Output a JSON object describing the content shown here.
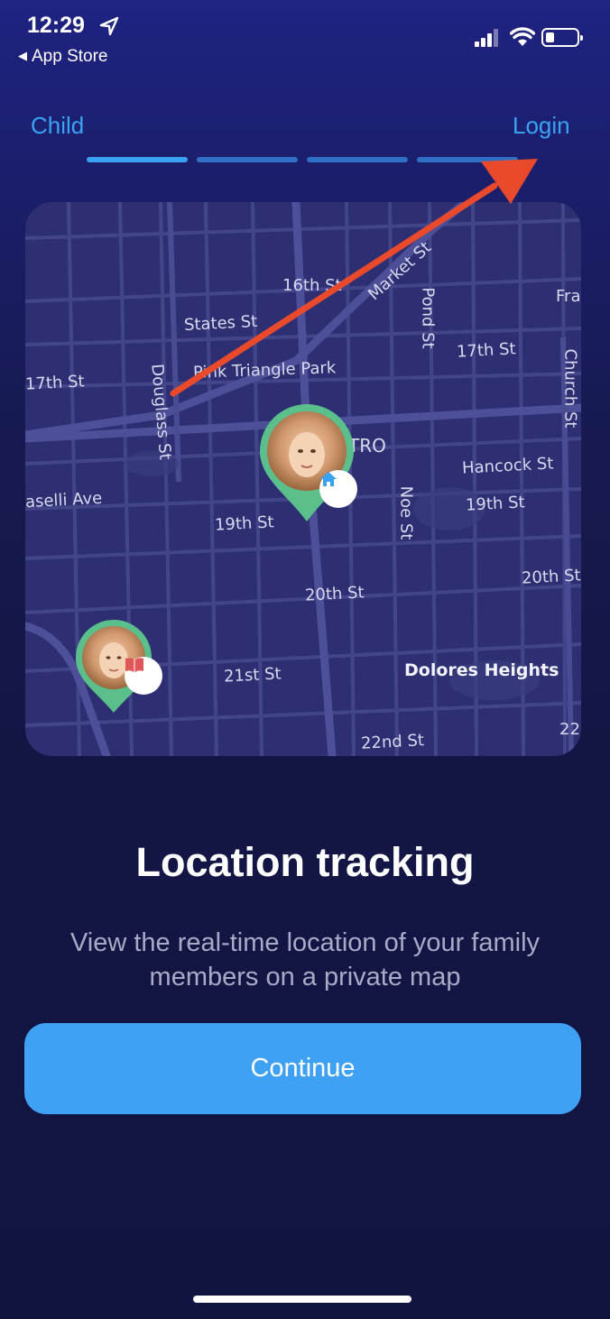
{
  "status_bar": {
    "time": "12:29",
    "back_app": "App Store",
    "icons": [
      "location-arrow-icon",
      "cellular-signal-icon",
      "wifi-icon",
      "battery-icon"
    ]
  },
  "header": {
    "left_label": "Child",
    "right_label": "Login",
    "progress": {
      "total_steps": 4,
      "current_step": 1
    }
  },
  "map": {
    "labels": [
      "16th St",
      "States St",
      "Market St",
      "Pond St",
      "Fra",
      "17th St",
      "17th St",
      "Church St",
      "Pink Triangle Park",
      "Douglass St",
      "TRO",
      "Hancock St",
      "aselli Ave",
      "Noe St",
      "19th St",
      "19th St",
      "20th St",
      "20th St",
      "21st St",
      "Dolores Heights",
      "22nd St",
      "22"
    ],
    "pins": [
      {
        "name": "child-pin-home",
        "badge_icon": "home-icon"
      },
      {
        "name": "child-pin-school",
        "badge_icon": "book-icon"
      }
    ]
  },
  "content": {
    "title": "Location tracking",
    "description": "View the real-time location of your family members on a private map",
    "continue_label": "Continue"
  },
  "colors": {
    "accent": "#3aa2f2",
    "button": "#3ea1f3",
    "progress_active": "#3aa2f2",
    "progress_inactive": "#2f6fc6",
    "pin_green": "#5bbf8c",
    "annotation_arrow": "#e84a2b",
    "badge_school": "#e0575a",
    "badge_home": "#3aa2f2"
  }
}
